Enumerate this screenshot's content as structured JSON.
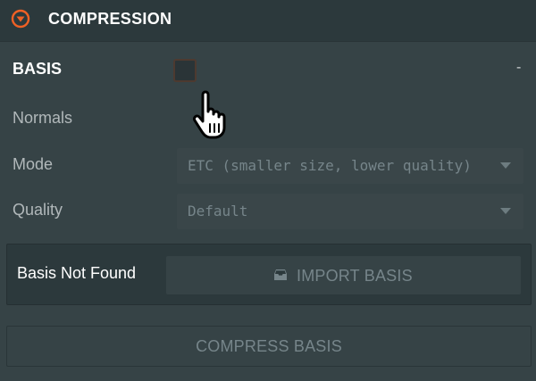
{
  "header": {
    "title": "COMPRESSION",
    "toggle_icon": "chevron-down-circle-icon",
    "accent_color": "#f06125"
  },
  "rows": {
    "basis": {
      "label": "BASIS",
      "checked": false,
      "trailing": "-"
    },
    "normals": {
      "label": "Normals"
    },
    "mode": {
      "label": "Mode",
      "value": "ETC (smaller size, lower quality)"
    },
    "quality": {
      "label": "Quality",
      "value": "Default"
    }
  },
  "basis_status": {
    "label": "Basis Not Found",
    "import_button": "IMPORT BASIS",
    "import_icon": "archive-icon"
  },
  "compress_button": "COMPRESS BASIS",
  "cursor_icon": "hand-pointer-icon"
}
